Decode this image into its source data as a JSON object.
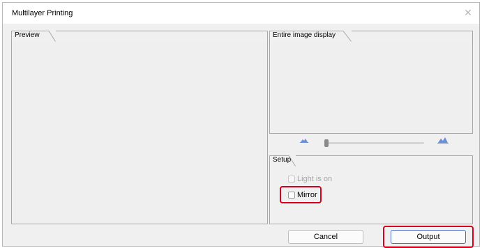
{
  "window": {
    "title": "Multilayer Printing",
    "close_glyph": "✕"
  },
  "preview": {
    "tab_label": "Preview"
  },
  "overview": {
    "tab_label": "Entire image display",
    "zoom_out_icon": "zoom-out-icon",
    "zoom_in_icon": "zoom-in-icon",
    "zoom_level": 0
  },
  "setup": {
    "tab_label": "Setup",
    "light_label": "Light is on",
    "light_checked": false,
    "light_enabled": false,
    "mirror_label": "Mirror",
    "mirror_checked": false
  },
  "footer": {
    "cancel_label": "Cancel",
    "output_label": "Output"
  },
  "colors": {
    "highlight": "#d8001c",
    "primary_border": "#4f6ec7",
    "dialog_bg": "#f0f0f0"
  }
}
